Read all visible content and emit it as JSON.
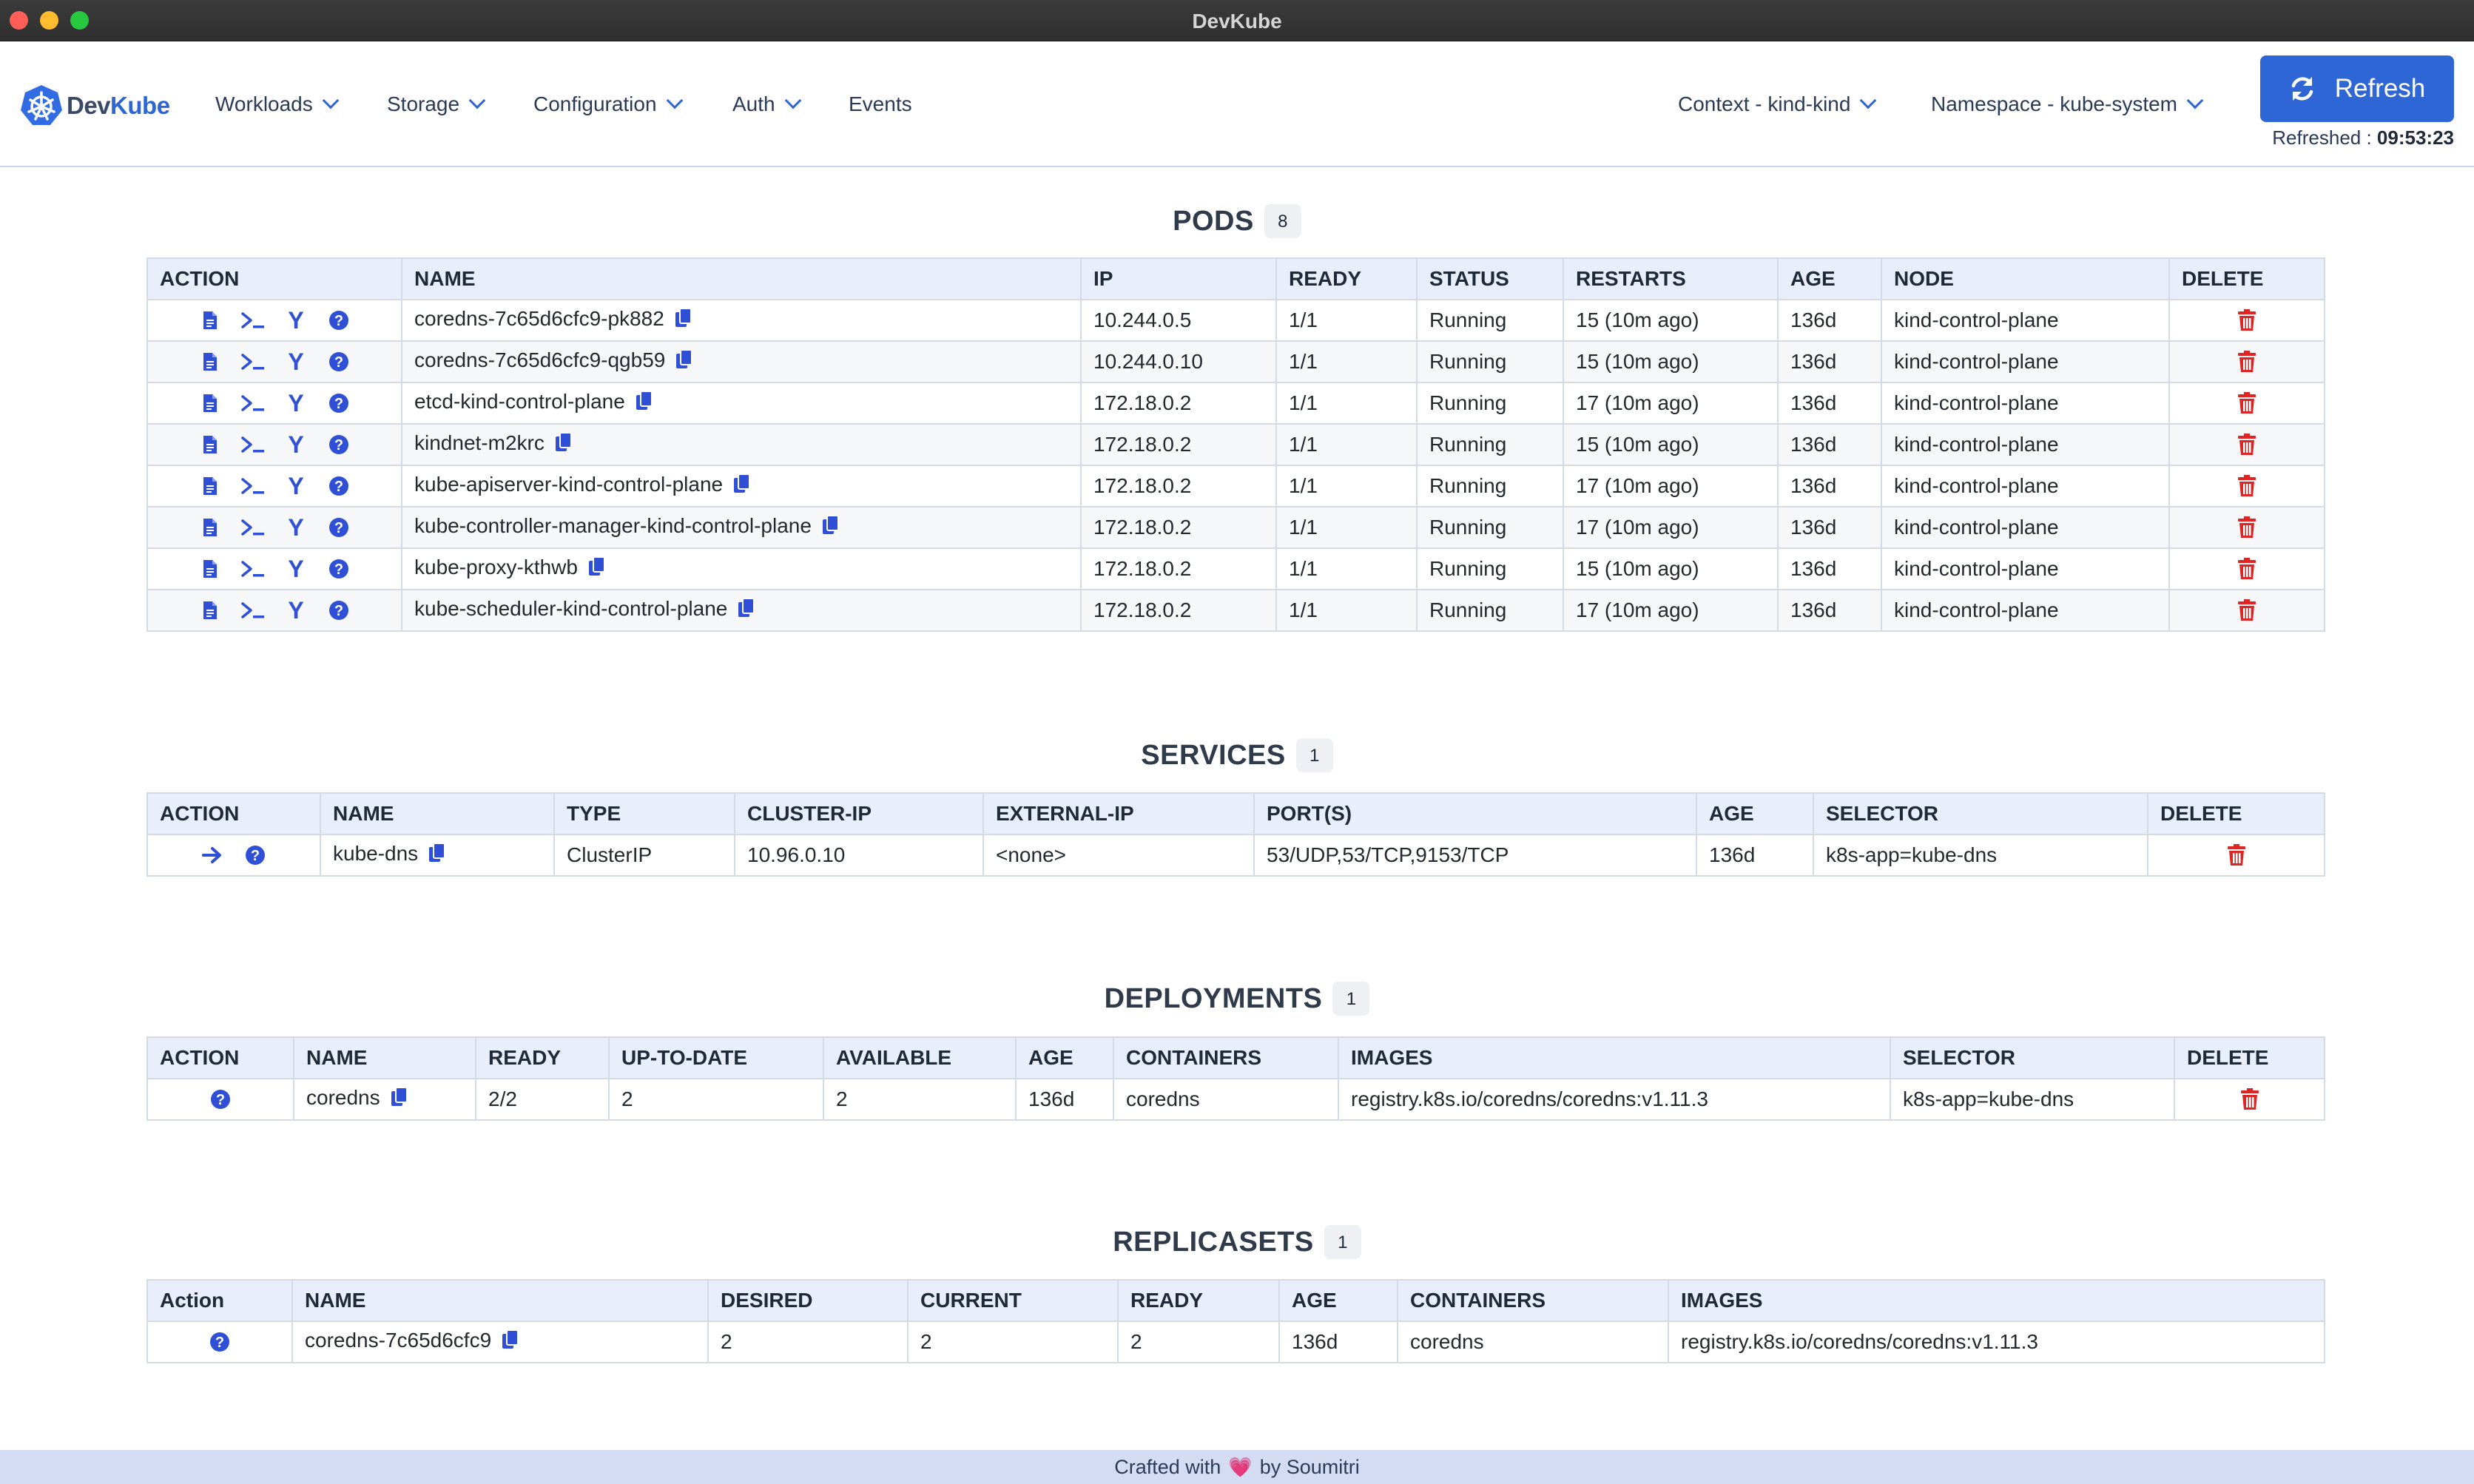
{
  "window": {
    "title": "DevKube"
  },
  "brand": {
    "part1": "Dev",
    "part2": "Kube"
  },
  "nav": {
    "items": [
      {
        "label": "Workloads",
        "has_dropdown": true
      },
      {
        "label": "Storage",
        "has_dropdown": true
      },
      {
        "label": "Configuration",
        "has_dropdown": true
      },
      {
        "label": "Auth",
        "has_dropdown": true
      },
      {
        "label": "Events",
        "has_dropdown": false
      }
    ],
    "context": "Context - kind-kind",
    "namespace": "Namespace - kube-system",
    "refresh_label": "Refresh",
    "refreshed_label": "Refreshed :",
    "refreshed_time": "09:53:23"
  },
  "colors": {
    "accent": "#2f66d6",
    "delete": "#e02424",
    "header_bg": "#e8eefa",
    "footer_bg": "#d4dcf3"
  },
  "pods": {
    "title": "PODS",
    "count": "8",
    "columns": [
      "ACTION",
      "NAME",
      "IP",
      "READY",
      "STATUS",
      "RESTARTS",
      "AGE",
      "NODE",
      "DELETE"
    ],
    "rows": [
      {
        "name": "coredns-7c65d6cfc9-pk882",
        "ip": "10.244.0.5",
        "ready": "1/1",
        "status": "Running",
        "restarts": "15 (10m ago)",
        "age": "136d",
        "node": "kind-control-plane"
      },
      {
        "name": "coredns-7c65d6cfc9-qgb59",
        "ip": "10.244.0.10",
        "ready": "1/1",
        "status": "Running",
        "restarts": "15 (10m ago)",
        "age": "136d",
        "node": "kind-control-plane"
      },
      {
        "name": "etcd-kind-control-plane",
        "ip": "172.18.0.2",
        "ready": "1/1",
        "status": "Running",
        "restarts": "17 (10m ago)",
        "age": "136d",
        "node": "kind-control-plane"
      },
      {
        "name": "kindnet-m2krc",
        "ip": "172.18.0.2",
        "ready": "1/1",
        "status": "Running",
        "restarts": "15 (10m ago)",
        "age": "136d",
        "node": "kind-control-plane"
      },
      {
        "name": "kube-apiserver-kind-control-plane",
        "ip": "172.18.0.2",
        "ready": "1/1",
        "status": "Running",
        "restarts": "17 (10m ago)",
        "age": "136d",
        "node": "kind-control-plane"
      },
      {
        "name": "kube-controller-manager-kind-control-plane",
        "ip": "172.18.0.2",
        "ready": "1/1",
        "status": "Running",
        "restarts": "17 (10m ago)",
        "age": "136d",
        "node": "kind-control-plane"
      },
      {
        "name": "kube-proxy-kthwb",
        "ip": "172.18.0.2",
        "ready": "1/1",
        "status": "Running",
        "restarts": "15 (10m ago)",
        "age": "136d",
        "node": "kind-control-plane"
      },
      {
        "name": "kube-scheduler-kind-control-plane",
        "ip": "172.18.0.2",
        "ready": "1/1",
        "status": "Running",
        "restarts": "17 (10m ago)",
        "age": "136d",
        "node": "kind-control-plane"
      }
    ]
  },
  "services": {
    "title": "SERVICES",
    "count": "1",
    "columns": [
      "ACTION",
      "NAME",
      "TYPE",
      "CLUSTER-IP",
      "EXTERNAL-IP",
      "PORT(S)",
      "AGE",
      "SELECTOR",
      "DELETE"
    ],
    "rows": [
      {
        "name": "kube-dns",
        "type": "ClusterIP",
        "cluster_ip": "10.96.0.10",
        "external_ip": "<none>",
        "ports": "53/UDP,53/TCP,9153/TCP",
        "age": "136d",
        "selector": "k8s-app=kube-dns"
      }
    ]
  },
  "deployments": {
    "title": "DEPLOYMENTS",
    "count": "1",
    "columns": [
      "ACTION",
      "NAME",
      "READY",
      "UP-TO-DATE",
      "AVAILABLE",
      "AGE",
      "CONTAINERS",
      "IMAGES",
      "SELECTOR",
      "DELETE"
    ],
    "rows": [
      {
        "name": "coredns",
        "ready": "2/2",
        "up_to_date": "2",
        "available": "2",
        "age": "136d",
        "containers": "coredns",
        "images": "registry.k8s.io/coredns/coredns:v1.11.3",
        "selector": "k8s-app=kube-dns"
      }
    ]
  },
  "replicasets": {
    "title": "REPLICASETS",
    "count": "1",
    "columns": [
      "Action",
      "NAME",
      "DESIRED",
      "CURRENT",
      "READY",
      "AGE",
      "CONTAINERS",
      "IMAGES"
    ],
    "rows": [
      {
        "name": "coredns-7c65d6cfc9",
        "desired": "2",
        "current": "2",
        "ready": "2",
        "age": "136d",
        "containers": "coredns",
        "images": "registry.k8s.io/coredns/coredns:v1.11.3"
      }
    ]
  },
  "footer": {
    "prefix": "Crafted with",
    "heart": "💗",
    "suffix": "by Soumitri"
  }
}
